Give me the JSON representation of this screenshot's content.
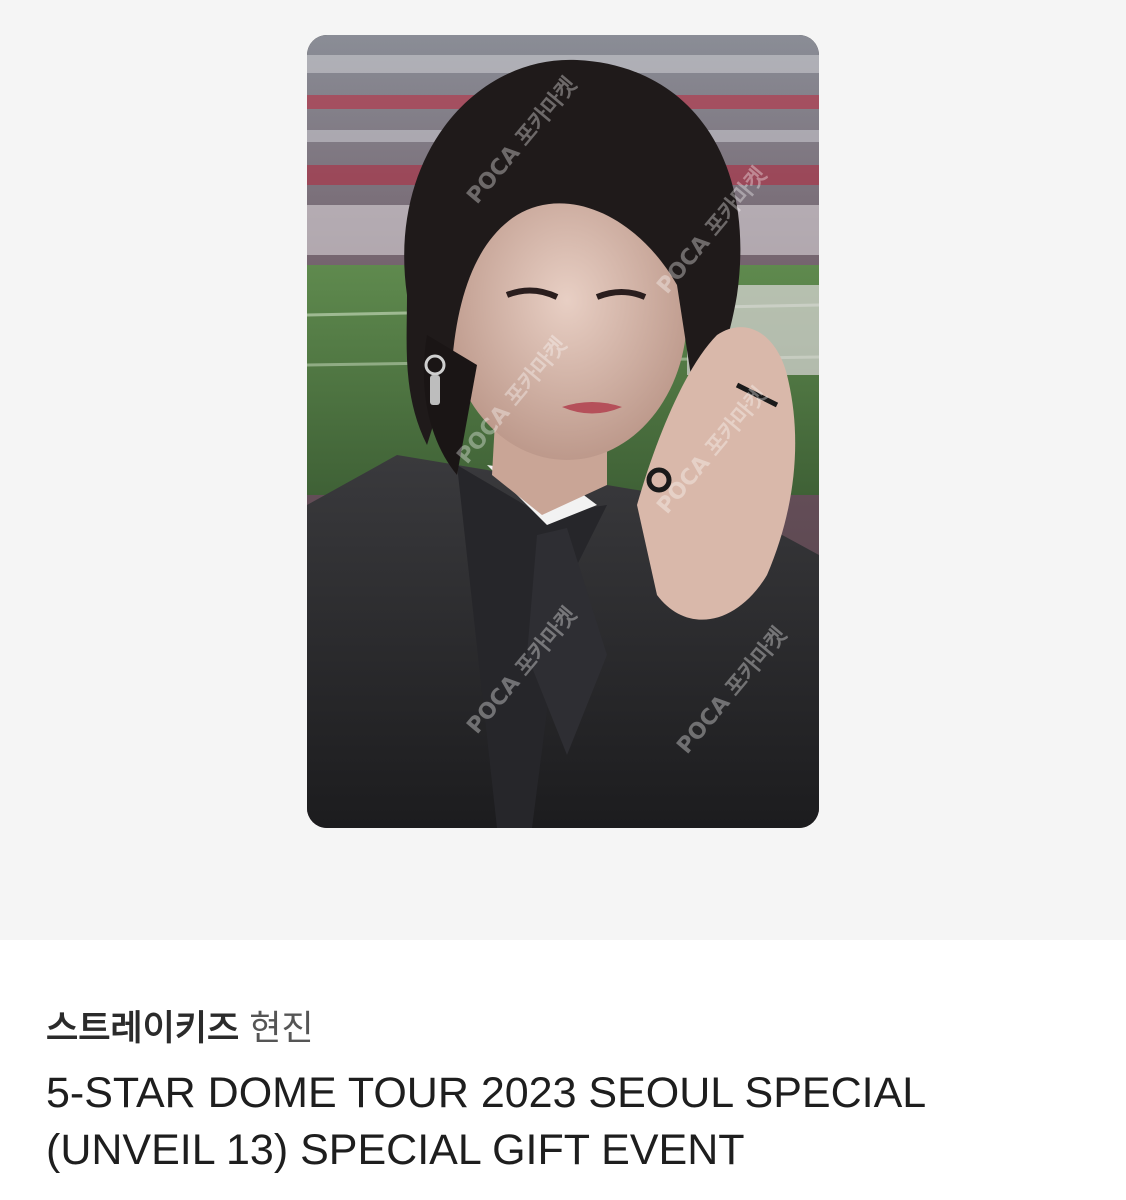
{
  "product": {
    "image": {
      "description_icon": "photocard-image",
      "watermark_text": "POCA 포카마켓"
    },
    "artist": "스트레이키즈",
    "member": "현진",
    "title_lines": [
      "5-STAR DOME TOUR 2023 SEOUL SPECIAL",
      "(UNVEIL 13) SPECIAL GIFT EVENT"
    ]
  },
  "colors": {
    "image_bg": "#f5f5f5",
    "text_primary": "#1e1e1e",
    "text_secondary": "#555555"
  }
}
